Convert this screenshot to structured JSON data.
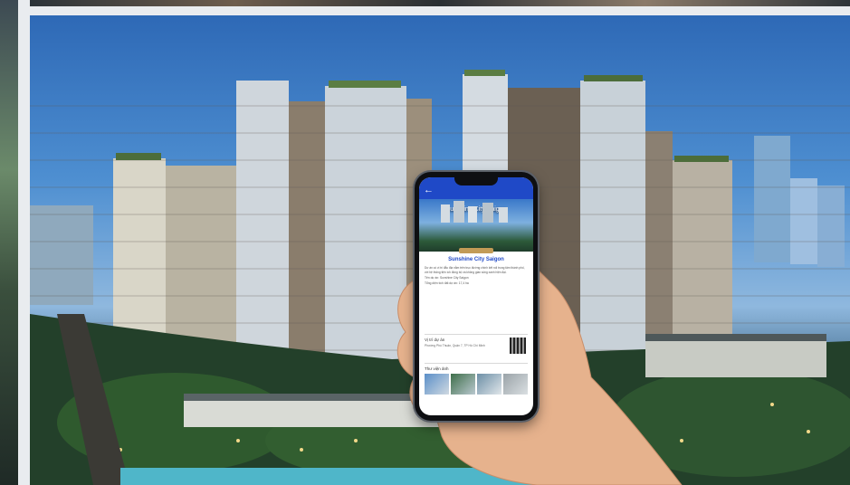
{
  "scene": {
    "description_colors": {
      "sky": "#4e8fd1",
      "city_lights": "#f3d98a"
    }
  },
  "phone": {
    "app_bar": {
      "back_icon": "arrow-left-icon"
    },
    "hero_title": "Sunshine City Saigon",
    "heading": "Sunshine City Saigon",
    "intro": "Dự án có vị trí đắc địa nằm trên trục đường chính kết nối trung tâm thành phố, với hệ thống tiện ích đồng bộ và không gian sống xanh hiện đại.",
    "bullets": [
      "Tên dự án: Sunshine City Saigon",
      "Tổng diện tích đất dự án: 17,4 ha"
    ],
    "location_title": "Vị trí dự án",
    "location_value": "Phường Phú Thuận, Quận 7, TP Hồ Chí Minh",
    "gallery_title": "Thư viện ảnh"
  }
}
